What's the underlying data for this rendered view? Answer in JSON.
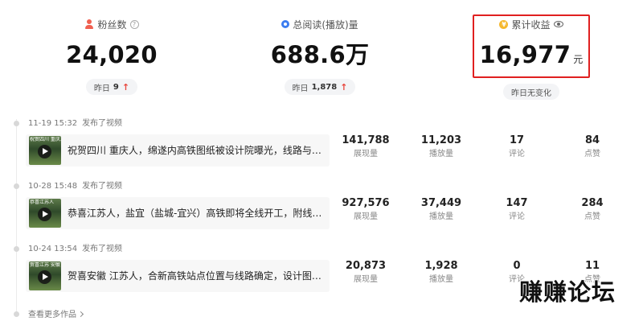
{
  "stats": [
    {
      "label": "粉丝数",
      "value": "24,020",
      "unit": "",
      "sub_prefix": "昨日",
      "sub_value": "9",
      "sub_trend": "↑"
    },
    {
      "label": "总阅读(播放)量",
      "value": "688.6万",
      "unit": "",
      "sub_prefix": "昨日",
      "sub_value": "1,878",
      "sub_trend": "↑"
    },
    {
      "label": "累计收益",
      "value": "16,977",
      "unit": "元",
      "sub_text": "昨日无变化"
    }
  ],
  "icons": {
    "followers": "person-icon",
    "followers_help": "help-icon",
    "reads": "drop-icon",
    "earnings": "coin-icon",
    "earnings_visibility": "eye-icon"
  },
  "colors": {
    "trend_up": "#e8453c",
    "highlight": "#e02020",
    "reads_icon": "#3b7cf0",
    "coin": "#f5b82e"
  },
  "posts": [
    {
      "date": "11-19 15:32",
      "action": "发布了视频",
      "thumb_text": "祝贺四川 重庆人",
      "title": "祝贺四川 重庆人，绵遂内高铁图纸被设计院曝光，线路与站点...",
      "metrics": [
        {
          "value": "141,788",
          "label": "展现量"
        },
        {
          "value": "11,203",
          "label": "播放量"
        },
        {
          "value": "17",
          "label": "评论"
        },
        {
          "value": "84",
          "label": "点赞"
        }
      ]
    },
    {
      "date": "10-28 15:48",
      "action": "发布了视频",
      "thumb_text": "恭喜江苏人",
      "title": "恭喜江苏人，盐宜（盐城-宜兴）高铁即将全线开工，附线路走...",
      "metrics": [
        {
          "value": "927,576",
          "label": "展现量"
        },
        {
          "value": "37,449",
          "label": "播放量"
        },
        {
          "value": "147",
          "label": "评论"
        },
        {
          "value": "284",
          "label": "点赞"
        }
      ]
    },
    {
      "date": "10-24 13:54",
      "action": "发布了视频",
      "thumb_text": "贺喜江苏 安徽",
      "title": "贺喜安徽 江苏人，合新高铁站点位置与线路确定，设计图纸被...",
      "metrics": [
        {
          "value": "20,873",
          "label": "展现量"
        },
        {
          "value": "1,928",
          "label": "播放量"
        },
        {
          "value": "0",
          "label": "评论"
        },
        {
          "value": "11",
          "label": "点赞"
        }
      ]
    }
  ],
  "see_more": "查看更多作品",
  "watermark": "赚赚论坛"
}
